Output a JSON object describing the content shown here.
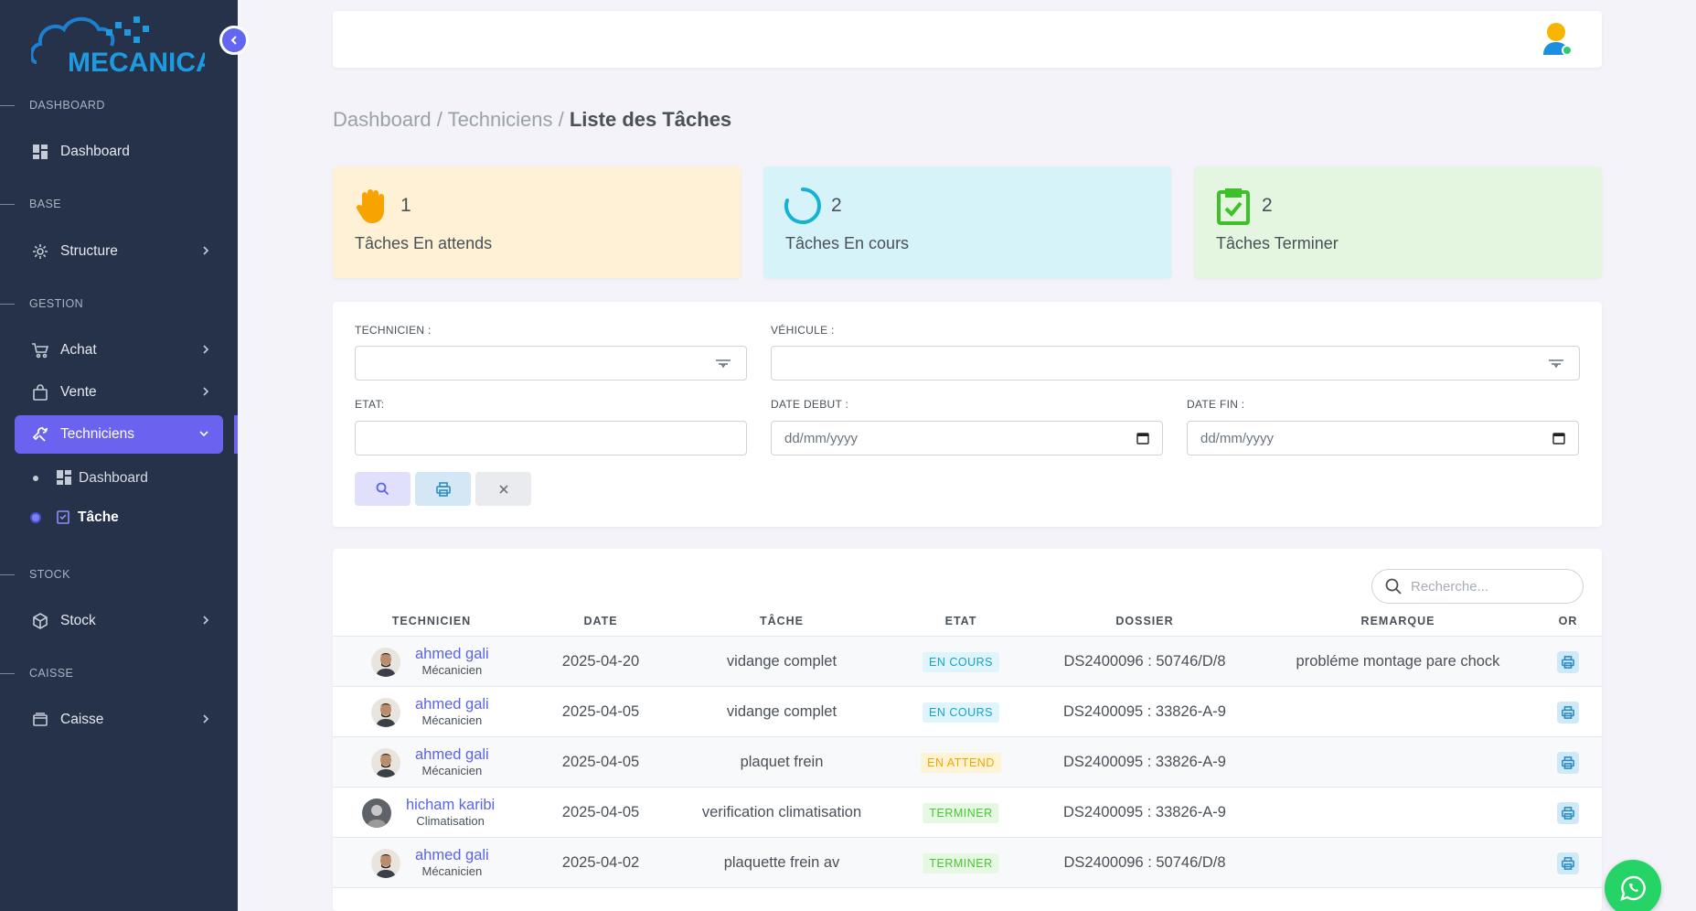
{
  "app": {
    "logo_text": "MECANICA"
  },
  "sidebar": {
    "sections": [
      {
        "title": "DASHBOARD"
      },
      {
        "title": "BASE"
      },
      {
        "title": "GESTION"
      },
      {
        "title": "STOCK"
      },
      {
        "title": "CAISSE"
      }
    ],
    "items": [
      {
        "label": "Dashboard",
        "icon": "grid-icon"
      },
      {
        "label": "Structure",
        "icon": "gear-icon"
      },
      {
        "label": "Achat",
        "icon": "cart-icon"
      },
      {
        "label": "Vente",
        "icon": "bag-icon"
      },
      {
        "label": "Techniciens",
        "icon": "wrench-icon"
      },
      {
        "label": "Stock",
        "icon": "box-icon"
      },
      {
        "label": "Caisse",
        "icon": "wallet-icon"
      }
    ],
    "subitems": [
      {
        "label": "Dashboard"
      },
      {
        "label": "Tâche"
      }
    ]
  },
  "breadcrumb": {
    "part1": "Dashboard / Techniciens / ",
    "current": "Liste des Tâches"
  },
  "stats": [
    {
      "count": "1",
      "label": "Tâches En attends",
      "bg": "#fff1d6",
      "icon": "hand-icon"
    },
    {
      "count": "2",
      "label": "Tâches En cours",
      "bg": "#d7f3fa",
      "icon": "spinner-icon"
    },
    {
      "count": "2",
      "label": "Tâches Terminer",
      "bg": "#e4f6df",
      "icon": "clipboard-check-icon"
    }
  ],
  "filter": {
    "technicien_label": "TECHNICIEN :",
    "vehicule_label": "VÉHICULE :",
    "etat_label": "ETAT:",
    "date_debut_label": "DATE DEBUT :",
    "date_fin_label": "DATE FIN :",
    "date_placeholder": "dd/mm/yyyy"
  },
  "table": {
    "search_placeholder": "Recherche...",
    "headers": [
      "TECHNICIEN",
      "DATE",
      "TÂCHE",
      "ETAT",
      "DOSSIER",
      "REMARQUE",
      "OR"
    ],
    "rows": [
      {
        "name": "ahmed gali",
        "role": "Mécanicien",
        "date": "2025-04-20",
        "tache": "vidange complet",
        "etat": "EN COURS",
        "dossier": "DS2400096 : 50746/D/8",
        "remarque": "probléme montage pare chock"
      },
      {
        "name": "ahmed gali",
        "role": "Mécanicien",
        "date": "2025-04-05",
        "tache": "vidange complet",
        "etat": "EN COURS",
        "dossier": "DS2400095 : 33826-A-9",
        "remarque": ""
      },
      {
        "name": "ahmed gali",
        "role": "Mécanicien",
        "date": "2025-04-05",
        "tache": "plaquet frein",
        "etat": "EN ATTEND",
        "dossier": "DS2400095 : 33826-A-9",
        "remarque": ""
      },
      {
        "name": "hicham karibi",
        "role": "Climatisation",
        "date": "2025-04-05",
        "tache": "verification climatisation",
        "etat": "TERMINER",
        "dossier": "DS2400095 : 33826-A-9",
        "remarque": ""
      },
      {
        "name": "ahmed gali",
        "role": "Mécanicien",
        "date": "2025-04-02",
        "tache": "plaquette frein av",
        "etat": "TERMINER",
        "dossier": "DS2400096 : 50746/D/8",
        "remarque": ""
      }
    ]
  },
  "colors": {
    "sidebar_bg": "#25324a",
    "accent": "#6b63f0",
    "link": "#5b63e6"
  }
}
